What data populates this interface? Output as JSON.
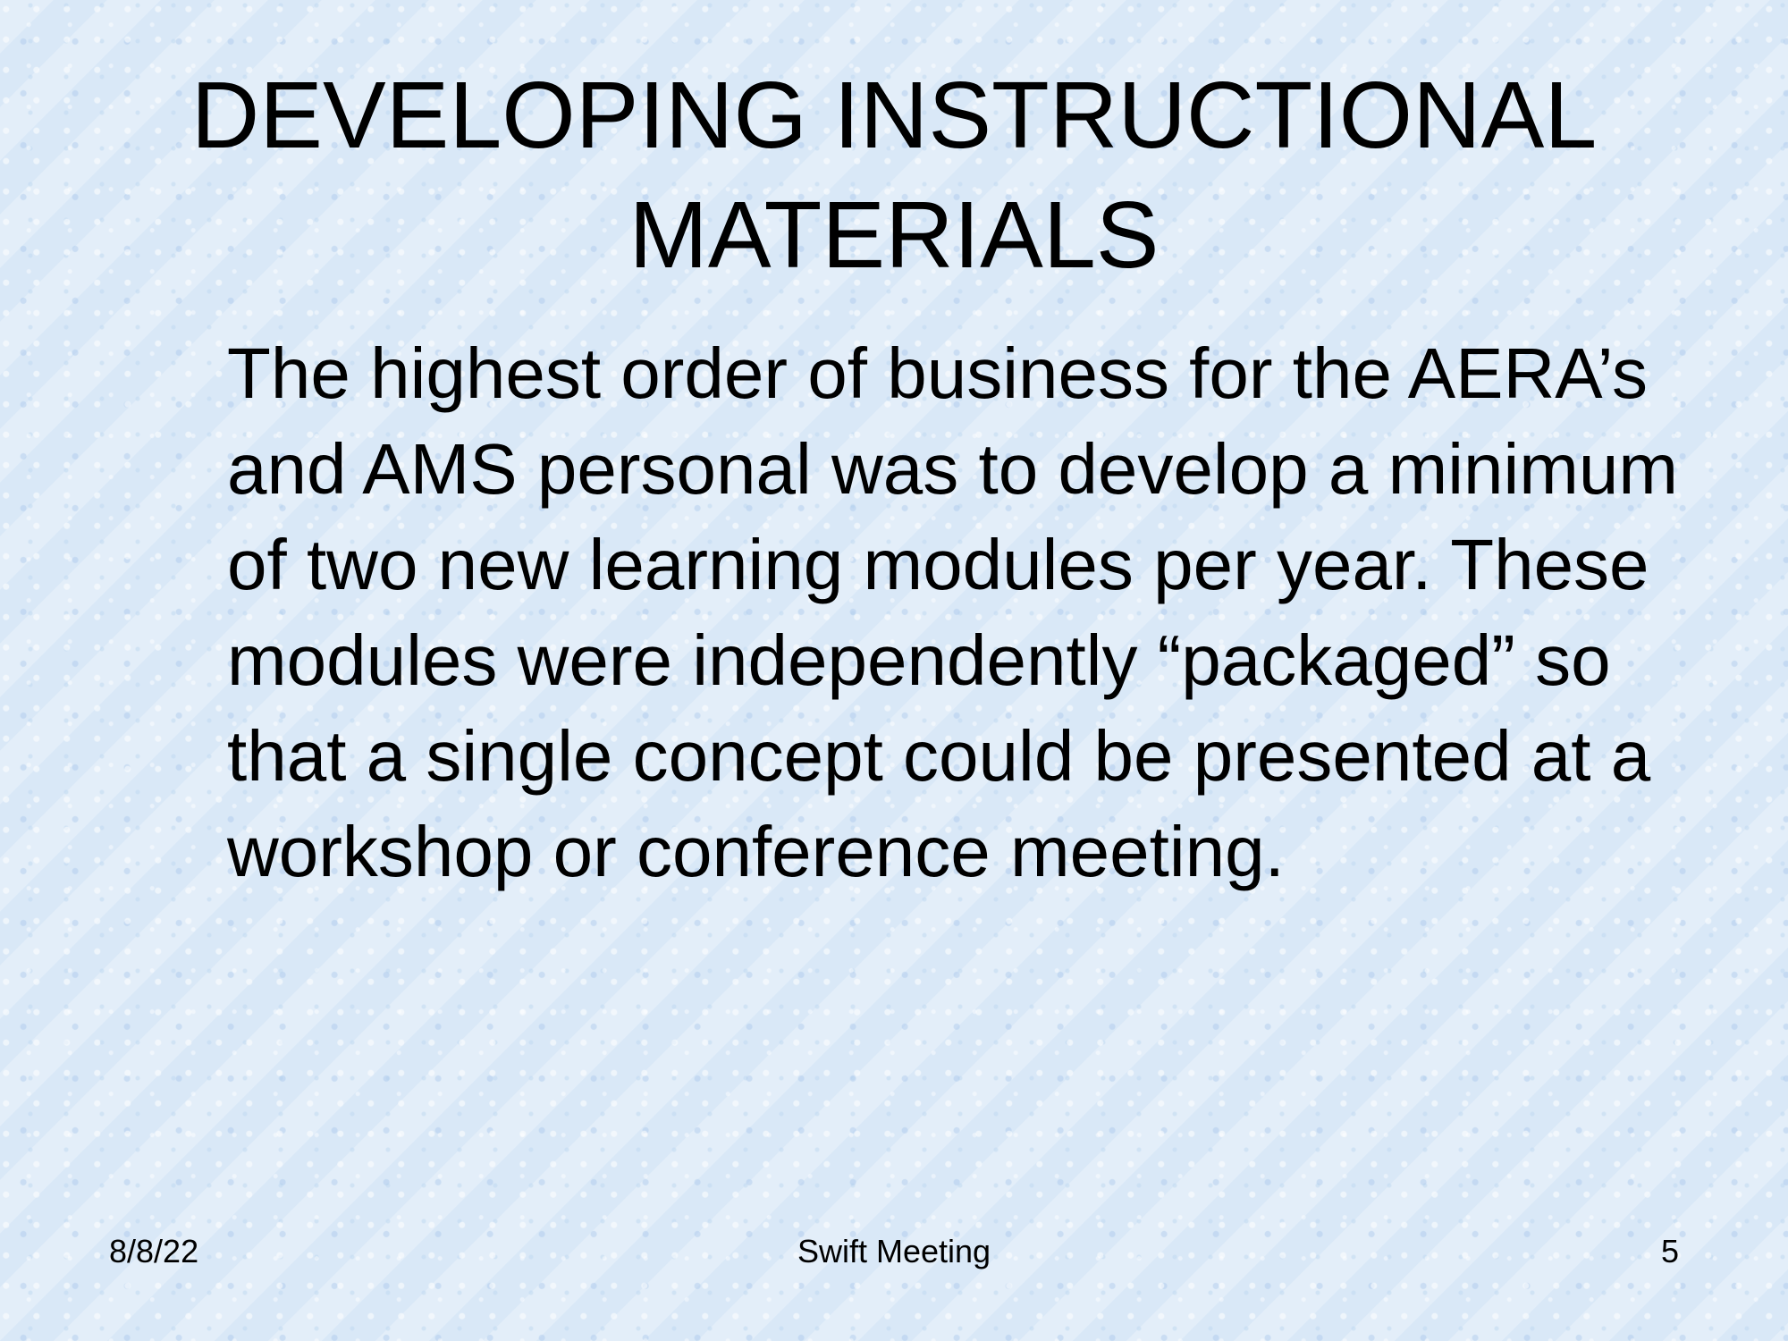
{
  "slide": {
    "title": "DEVELOPING INSTRUCTIONAL MATERIALS",
    "body": "The highest order of business for the AERA’s and AMS personal was to develop a minimum of two new learning modules per year.  These modules were independently “packaged” so that a single concept could be presented at a workshop or conference meeting.",
    "footer": {
      "date": "8/8/22",
      "center": "Swift Meeting",
      "page_number": "5"
    }
  },
  "colors": {
    "background": "#d9e8f7",
    "text": "#000000"
  }
}
